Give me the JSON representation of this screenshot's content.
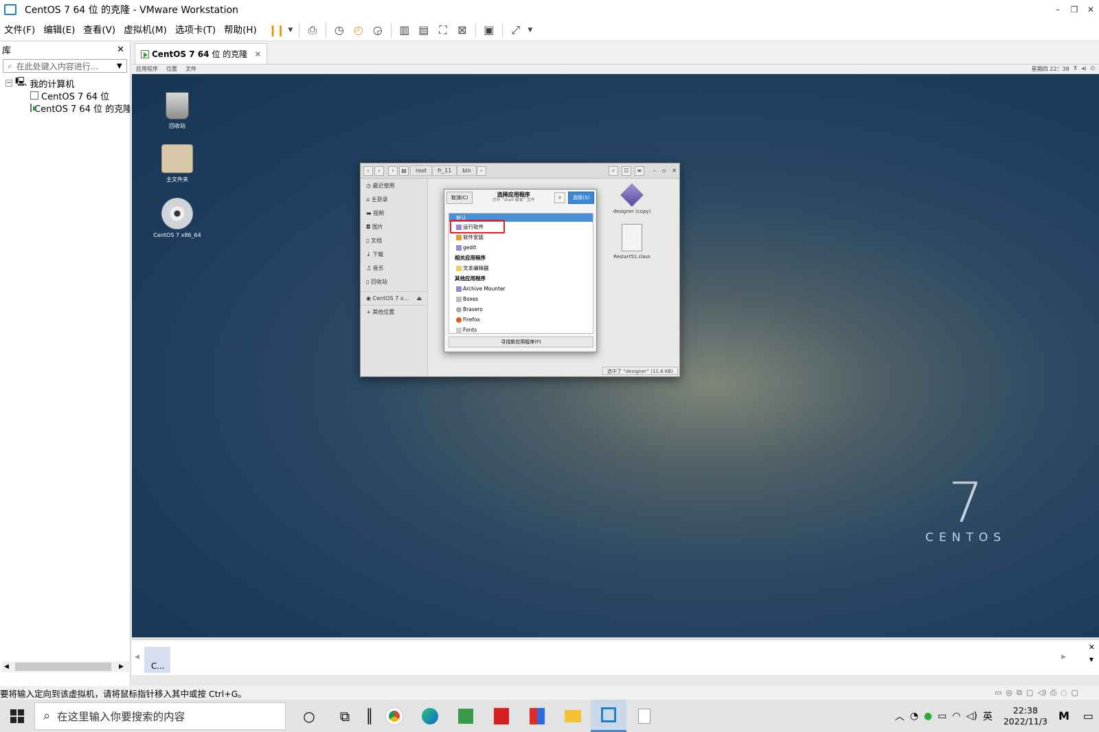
{
  "window": {
    "title": "CentOS 7 64 位 的克隆 - VMware Workstation"
  },
  "menus": [
    "文件(F)",
    "编辑(E)",
    "查看(V)",
    "虚拟机(M)",
    "选项卡(T)",
    "帮助(H)"
  ],
  "library": {
    "title": "库",
    "search_placeholder": "在此处键入内容进行...",
    "tree": {
      "root": "我的计算机",
      "vms": [
        "CentOS 7 64 位",
        "CentOS 7 64 位 的克隆"
      ]
    }
  },
  "tab": {
    "name_bold": "CentOS 7 64",
    "name_rest": "位 的克隆"
  },
  "gnome": {
    "apps": "应用程序",
    "places": "位置",
    "files": "文件",
    "clock": "星期四 22：38"
  },
  "desktop": {
    "icons": [
      "回收站",
      "主文件夹",
      "CentOS 7 x86_64"
    ],
    "brand_num": "7",
    "brand_word": "CENTOS"
  },
  "nautilus": {
    "crumbs": [
      "root",
      "fr_11",
      "bin"
    ],
    "sidebar": [
      "最近使用",
      "主目录",
      "视频",
      "图片",
      "文档",
      "下载",
      "音乐",
      "回收站",
      "CentOS 7 x…",
      "其他位置"
    ],
    "files": [
      "designer (copy)",
      "Restart51.class"
    ],
    "status": "选中了 “designer” (11.6 KB)"
  },
  "dialog": {
    "cancel": "取消(C)",
    "title": "选择应用程序",
    "subtitle": "打开 “shell 脚本” 文件",
    "select": "选择(S)",
    "rows": [
      {
        "text": "默认",
        "type": "sel"
      },
      {
        "text": "运行软件",
        "type": "item"
      },
      {
        "text": "软件安装",
        "type": "item"
      },
      {
        "text": "gedit",
        "type": "item"
      },
      {
        "text": "相关应用程序",
        "type": "hdr"
      },
      {
        "text": "文本编辑器",
        "type": "item"
      },
      {
        "text": "其他应用程序",
        "type": "hdr"
      },
      {
        "text": "Archive Mounter",
        "type": "item"
      },
      {
        "text": "Boxes",
        "type": "item"
      },
      {
        "text": "Brasero",
        "type": "item"
      },
      {
        "text": "Firefox",
        "type": "item"
      },
      {
        "text": "Fonts",
        "type": "item"
      }
    ],
    "find": "寻找新应用程序(F)"
  },
  "vmtask": "bin",
  "thumb": "C...",
  "status_text": "要将输入定向到该虚拟机，请将鼠标指针移入其中或按 Ctrl+G。",
  "taskbar": {
    "search": "在这里输入你要搜索的内容",
    "ime": "英",
    "time": "22:38",
    "date": "2022/11/3"
  },
  "colors": {
    "accent": "#3d88d6",
    "highlight_box": "#e02020",
    "pause": "#f08c00"
  }
}
